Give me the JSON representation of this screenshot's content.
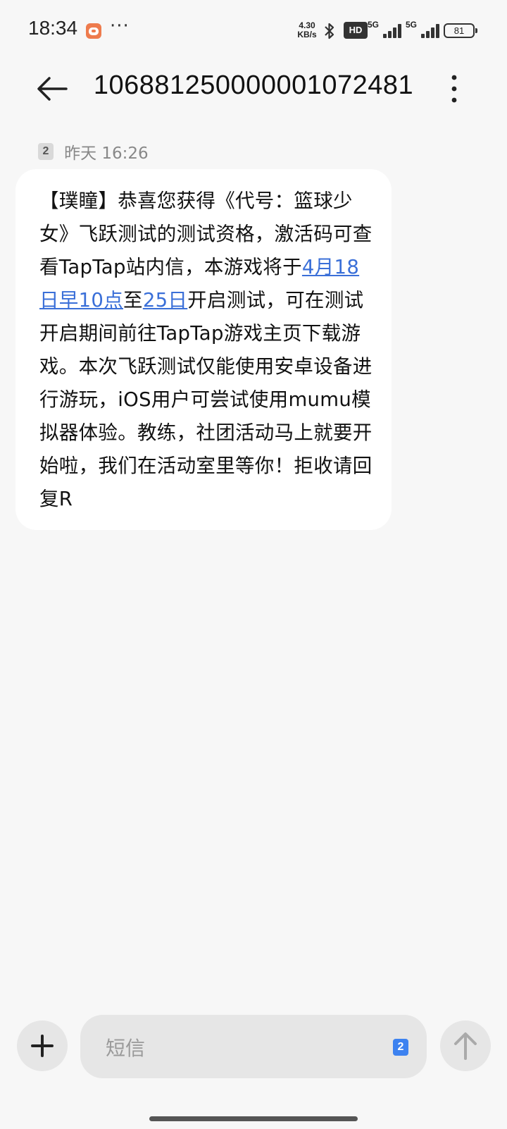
{
  "status_bar": {
    "time": "18:34",
    "more": "···",
    "net_speed_value": "4.30",
    "net_speed_unit": "KB/s",
    "hd_label": "HD",
    "sim1_label": "5G",
    "sim2_label": "5G",
    "battery": "81"
  },
  "header": {
    "title": "106881250000001072481"
  },
  "message": {
    "sim_badge": "2",
    "timestamp": "昨天 16:26",
    "text_1": "【璞瞳】恭喜您获得《代号：篮球少女》飞跃测试的测试资格，激活码可查看TapTap站内信，本游戏将于",
    "link_1": "4月18日早10点",
    "text_2": "至",
    "link_2": "25日",
    "text_3": "开启测试，可在测试开启期间前往TapTap游戏主页下载游戏。本次飞跃测试仅能使用安卓设备进行游玩，iOS用户可尝试使用mumu模拟器体验。教练，社团活动马上就要开始啦，我们在活动室里等你！拒收请回复R"
  },
  "composer": {
    "placeholder": "短信",
    "sim_badge": "2"
  },
  "colors": {
    "background": "#f7f7f7",
    "bubble": "#ffffff",
    "link": "#3a6fd8",
    "sim_accent": "#3d82f0"
  }
}
